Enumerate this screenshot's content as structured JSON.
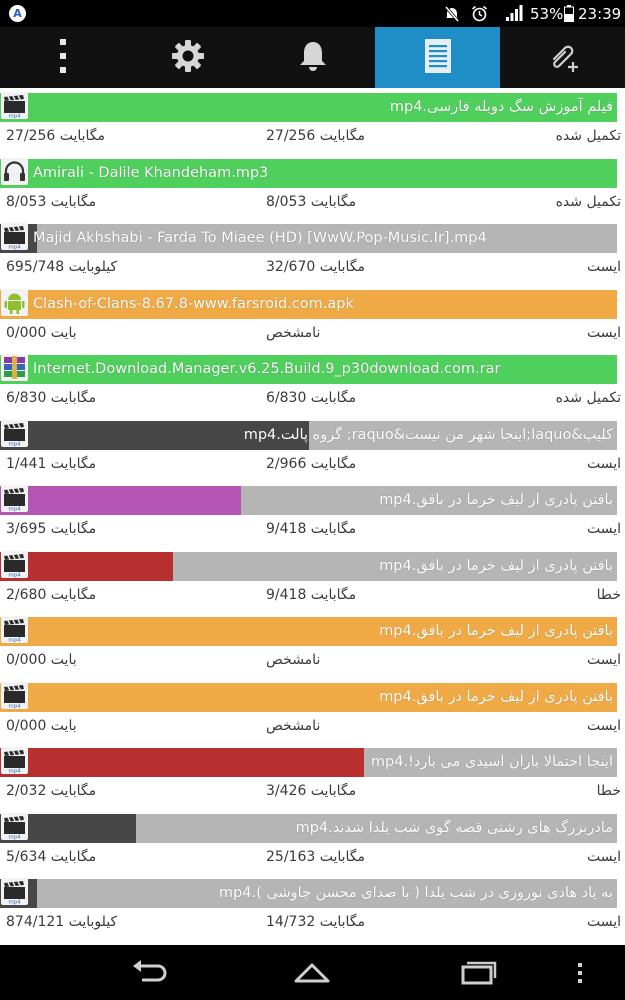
{
  "status_bar": {
    "app_badge": "A",
    "battery": "53%",
    "time": "23:39",
    "icons": [
      "mute-icon",
      "alarm-icon",
      "signal-icon",
      "battery-icon"
    ]
  },
  "tabs": [
    {
      "name": "menu",
      "icon": "more-vertical-icon",
      "active": false
    },
    {
      "name": "settings",
      "icon": "gear-icon",
      "active": false
    },
    {
      "name": "notifications",
      "icon": "bell-icon",
      "active": false
    },
    {
      "name": "downloads",
      "icon": "document-list-icon",
      "active": true
    },
    {
      "name": "add",
      "icon": "attachment-add-icon",
      "active": false
    }
  ],
  "colors": {
    "complete": "#4fcf5c",
    "paused": "#474747",
    "unknown": "#f0aa45",
    "error": "#b7302f",
    "active_purple": "#b454b4",
    "track": "#b5b5b5",
    "tab_active": "#1f8ec6"
  },
  "downloads": [
    {
      "name": "فیلم آموزش سگ دوبله فارسی.mp4",
      "dir": "rtl",
      "type": "video",
      "status": "تکمیل شده",
      "downloaded": "27/256 مگابایت",
      "total": "27/256 مگابایت",
      "progress": 1.0,
      "color": "#4fcf5c"
    },
    {
      "name": "Amirali - Dalile Khandeham.mp3",
      "dir": "ltr",
      "type": "audio",
      "status": "تکمیل شده",
      "downloaded": "8/053 مگابایت",
      "total": "8/053 مگابایت",
      "progress": 1.0,
      "color": "#4fcf5c"
    },
    {
      "name": "Majid Akhshabi - Farda To Miaee (HD) [WwW.Pop-Music.Ir].mp4",
      "dir": "ltr",
      "type": "video",
      "status": "ایست",
      "downloaded": "32/670 مگابایت",
      "total": "695/748 کیلوبایت",
      "progress": 0.06,
      "color": "#474747"
    },
    {
      "name": "Clash-of-Clans-8.67.8-www.farsroid.com.apk",
      "dir": "ltr",
      "type": "apk",
      "status": "ایست",
      "downloaded": "نامشخص",
      "total": "0/000 بایت",
      "progress": 1.0,
      "color": "#f0aa45"
    },
    {
      "name": "Internet.Download.Manager.v6.25.Build.9_p30download.com.rar",
      "dir": "ltr",
      "type": "archive",
      "status": "تکمیل شده",
      "downloaded": "6/830 مگابایت",
      "total": "6/830 مگابایت",
      "progress": 1.0,
      "color": "#4fcf5c"
    },
    {
      "name": "کلیپ&laquo;اینجا شهر من نیست&raquo; گروه پالت.mp4",
      "dir": "rtl",
      "type": "video",
      "status": "ایست",
      "downloaded": "2/966 مگابایت",
      "total": "1/441 مگابایت",
      "progress": 0.5,
      "color": "#474747"
    },
    {
      "name": "بافتن پادری از لیف خرما در بافق.mp4",
      "dir": "rtl",
      "type": "video",
      "status": "ایست",
      "downloaded": "9/418 مگابایت",
      "total": "3/695 مگابایت",
      "progress": 0.39,
      "color": "#b454b4"
    },
    {
      "name": "بافتن پادری از لیف خرما در بافق.mp4",
      "dir": "rtl",
      "type": "video",
      "status": "خطا",
      "downloaded": "9/418 مگابایت",
      "total": "2/680 مگابایت",
      "progress": 0.28,
      "color": "#b7302f"
    },
    {
      "name": "بافتن پادری از لیف خرما در بافق.mp4",
      "dir": "rtl",
      "type": "video",
      "status": "ایست",
      "downloaded": "نامشخص",
      "total": "0/000 بایت",
      "progress": 1.0,
      "color": "#f0aa45"
    },
    {
      "name": "بافتن پادری از لیف خرما در بافق.mp4",
      "dir": "rtl",
      "type": "video",
      "status": "ایست",
      "downloaded": "نامشخص",
      "total": "0/000 بایت",
      "progress": 1.0,
      "color": "#f0aa45"
    },
    {
      "name": "اینجا احتمالا باران اسیدی می بارد!.mp4",
      "dir": "rtl",
      "type": "video",
      "status": "خطا",
      "downloaded": "3/426 مگابایت",
      "total": "2/032 مگابایت",
      "progress": 0.59,
      "color": "#b7302f"
    },
    {
      "name": "مادربزرگ های رشتی قصه گوی شب یلدا شدند.mp4",
      "dir": "rtl",
      "type": "video",
      "status": "ایست",
      "downloaded": "25/163 مگابایت",
      "total": "5/634 مگابایت",
      "progress": 0.22,
      "color": "#474747"
    },
    {
      "name": "به یاد هادی نوروزی در شب یلدا ( با صدای محسن چاوشی ).mp4",
      "dir": "rtl",
      "type": "video",
      "status": "ایست",
      "downloaded": "14/732 مگابایت",
      "total": "874/121 کیلوبایت",
      "progress": 0.06,
      "color": "#474747"
    }
  ],
  "nav_bar": [
    "back-icon",
    "home-icon",
    "recents-icon",
    "more-vertical-icon"
  ]
}
